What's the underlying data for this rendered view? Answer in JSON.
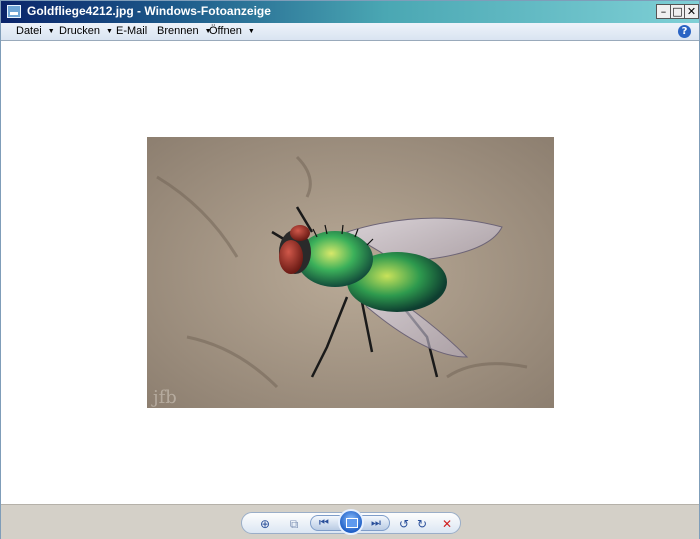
{
  "window": {
    "title": "Goldfliege4212.jpg - Windows-Fotoanzeige",
    "buttons": {
      "minimize": "–",
      "maximize": "□",
      "close": "✕"
    }
  },
  "menu": {
    "items": [
      {
        "label": "Datei",
        "has_dropdown": true
      },
      {
        "label": "Drucken",
        "has_dropdown": true
      },
      {
        "label": "E-Mail",
        "has_dropdown": false
      },
      {
        "label": "Brennen",
        "has_dropdown": true
      },
      {
        "label": "Öffnen",
        "has_dropdown": true
      }
    ],
    "help": "?"
  },
  "photo": {
    "description_icon": "fly-photo",
    "watermark": "jfb"
  },
  "controls": {
    "zoom": "⊕",
    "fit": "⧉",
    "prev": "⏮",
    "next": "⏭",
    "rotate_ccw": "↺",
    "rotate_cw": "↻",
    "delete": "✕"
  },
  "colors": {
    "titlebar_start": "#0a246a",
    "titlebar_end": "#7fd0d6",
    "accent": "#1f5fc6",
    "delete": "#d02020"
  }
}
